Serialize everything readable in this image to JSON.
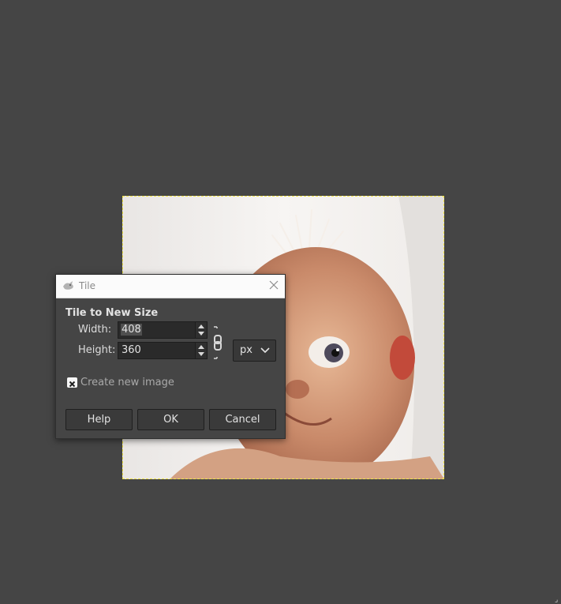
{
  "dialog": {
    "title": "Tile",
    "section_label": "Tile to New Size",
    "width_label": "Width:",
    "width_value": "408",
    "height_label": "Height:",
    "height_value": "360",
    "unit": "px",
    "create_new_image_label": "Create new image",
    "create_new_image_checked": true,
    "buttons": {
      "help": "Help",
      "ok": "OK",
      "cancel": "Cancel"
    }
  },
  "colors": {
    "canvas_bg": "#454545",
    "selection_border": "#f2e64a"
  }
}
